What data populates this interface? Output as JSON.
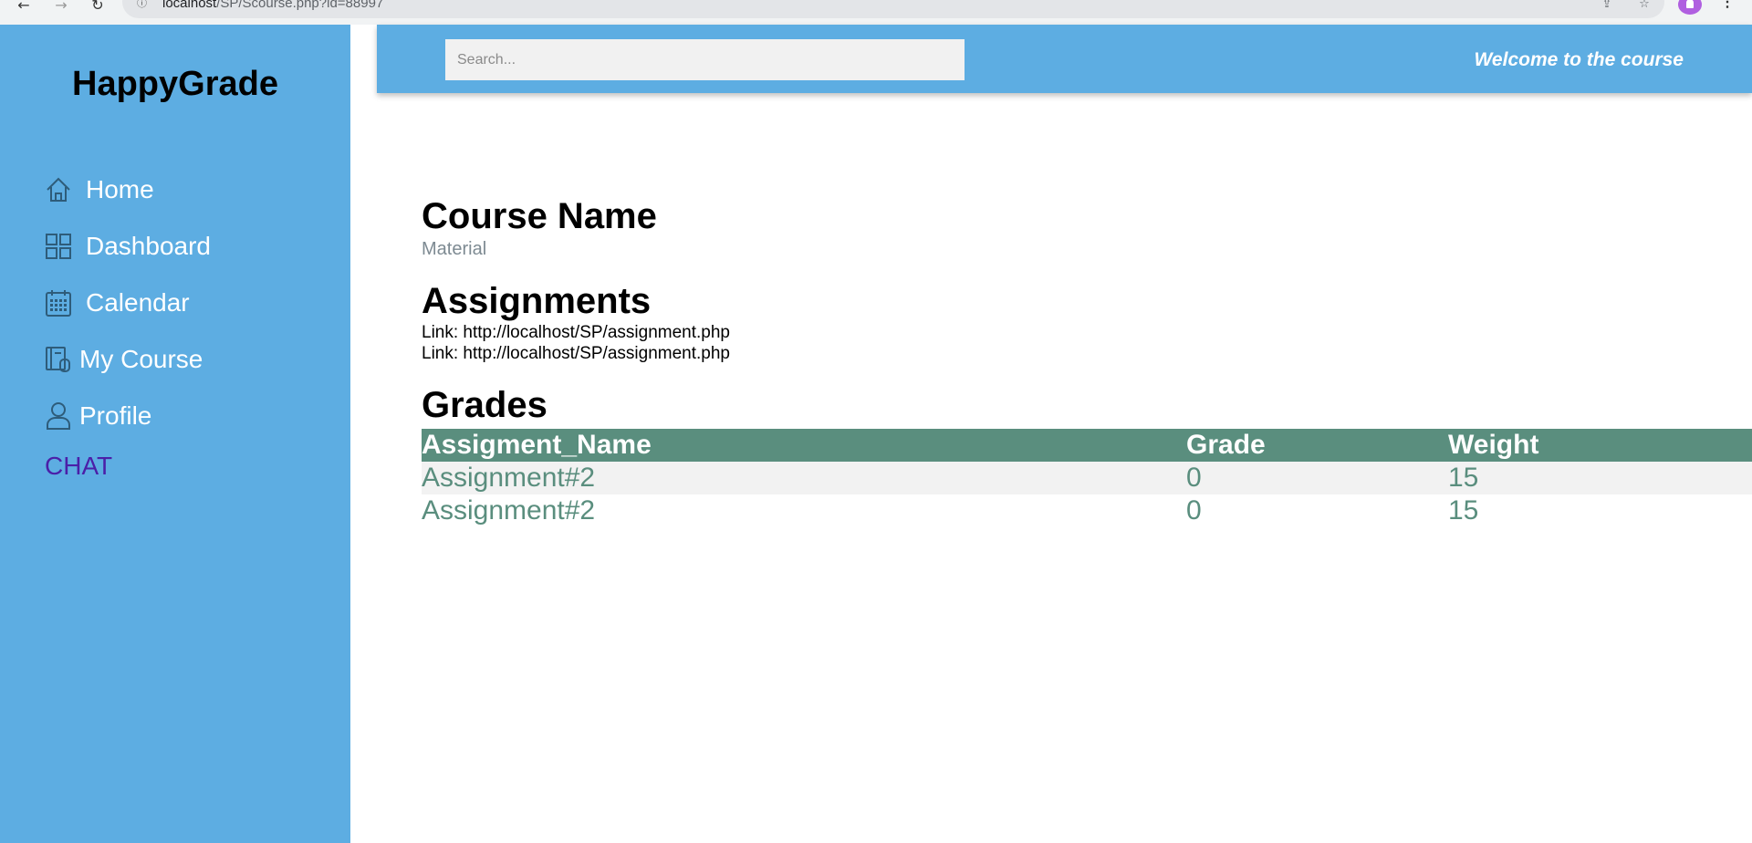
{
  "browser": {
    "url_host": "localhost",
    "url_path": "/SP/Scourse.php?id=88997"
  },
  "sidebar": {
    "brand": "HappyGrade",
    "items": [
      {
        "label": "Home",
        "icon": "home-icon"
      },
      {
        "label": "Dashboard",
        "icon": "dashboard-icon"
      },
      {
        "label": "Calendar",
        "icon": "calendar-icon"
      },
      {
        "label": "My Course",
        "icon": "course-icon"
      },
      {
        "label": "Profile",
        "icon": "profile-icon"
      }
    ],
    "chat_label": "CHAT"
  },
  "header": {
    "search_placeholder": "Search...",
    "welcome": "Welcome to the course"
  },
  "main": {
    "course_title": "Course Name",
    "material_label": "Material",
    "assignments_title": "Assignments",
    "links": [
      "Link: http://localhost/SP/assignment.php",
      "Link: http://localhost/SP/assignment.php"
    ],
    "grades_title": "Grades",
    "grades_table": {
      "headers": [
        "Assigment_Name",
        "Grade",
        "Weight"
      ],
      "rows": [
        [
          "Assignment#2",
          "0",
          "15"
        ],
        [
          "Assignment#2",
          "0",
          "15"
        ]
      ]
    }
  },
  "colors": {
    "sidebar_bg": "#5dade2",
    "table_header_bg": "#5a8e7e",
    "table_text": "#5a8e7e",
    "chat_link": "#4b1fa8"
  }
}
